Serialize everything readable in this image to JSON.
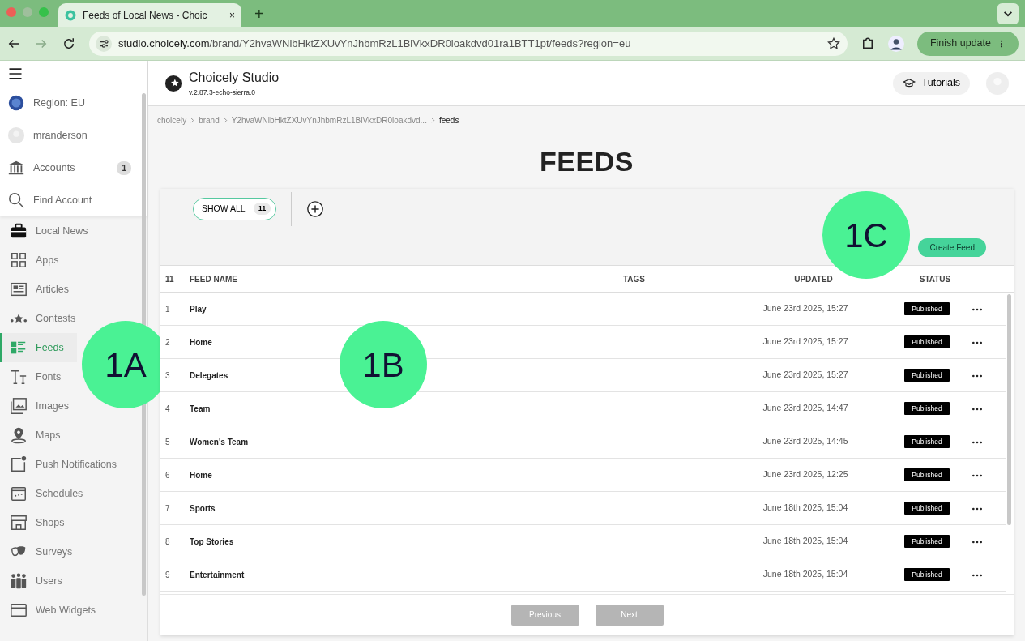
{
  "browser": {
    "tab_title": "Feeds of Local News - Choic",
    "tab_close": "×",
    "new_tab": "+",
    "url_host": "studio.choicely.com",
    "url_path": "/brand/Y2hvaWNlbHktZXUvYnJhbmRzL1BlVkxDR0loakdvd01ra1BTT1pt/feeds?region=eu",
    "update_button": "Finish update"
  },
  "sidebar": {
    "top_items": [
      {
        "kind": "region",
        "label": "Region: EU"
      },
      {
        "kind": "user",
        "label": "mranderson"
      },
      {
        "kind": "accounts",
        "label": "Accounts",
        "count": "1"
      },
      {
        "kind": "search",
        "label": "Find Account"
      }
    ],
    "items": [
      {
        "kind": "briefcase",
        "label": "Local News",
        "selected": false
      },
      {
        "kind": "apps",
        "label": "Apps",
        "selected": false
      },
      {
        "kind": "articles",
        "label": "Articles",
        "selected": false
      },
      {
        "kind": "contests",
        "label": "Contests",
        "selected": false
      },
      {
        "kind": "feeds",
        "label": "Feeds",
        "selected": true
      },
      {
        "kind": "fonts",
        "label": "Fonts",
        "selected": false
      },
      {
        "kind": "images",
        "label": "Images",
        "selected": false
      },
      {
        "kind": "maps",
        "label": "Maps",
        "selected": false
      },
      {
        "kind": "push",
        "label": "Push Notifications",
        "selected": false
      },
      {
        "kind": "schedules",
        "label": "Schedules",
        "selected": false
      },
      {
        "kind": "shops",
        "label": "Shops",
        "selected": false
      },
      {
        "kind": "surveys",
        "label": "Surveys",
        "selected": false
      },
      {
        "kind": "users",
        "label": "Users",
        "selected": false
      },
      {
        "kind": "widgets",
        "label": "Web Widgets",
        "selected": false
      }
    ]
  },
  "header": {
    "app_name": "Choicely Studio",
    "version": "v.2.87.3-echo-sierra.0",
    "tutorials": "Tutorials"
  },
  "breadcrumb": [
    "choicely",
    "brand",
    "Y2hvaWNlbHktZXUvYnJhbmRzL1BlVkxDR0loakdvd...",
    "feeds"
  ],
  "title": "FEEDS",
  "filters": [
    {
      "label": "SHOW ALL",
      "count": "11",
      "selected": true
    }
  ],
  "create_button": "Create Feed",
  "table": {
    "columns": [
      "11",
      "FEED NAME",
      "TAGS",
      "UPDATED",
      "STATUS"
    ],
    "rows": [
      {
        "index": "1",
        "name": "Play",
        "updated": "June 23rd 2025, 15:27",
        "status": "Published"
      },
      {
        "index": "2",
        "name": "Home",
        "updated": "June 23rd 2025, 15:27",
        "status": "Published"
      },
      {
        "index": "3",
        "name": "Delegates",
        "updated": "June 23rd 2025, 15:27",
        "status": "Published"
      },
      {
        "index": "4",
        "name": "Team",
        "updated": "June 23rd 2025, 14:47",
        "status": "Published"
      },
      {
        "index": "5",
        "name": "Women's Team",
        "updated": "June 23rd 2025, 14:45",
        "status": "Published"
      },
      {
        "index": "6",
        "name": "Home",
        "updated": "June 23rd 2025, 12:25",
        "status": "Published"
      },
      {
        "index": "7",
        "name": "Sports",
        "updated": "June 18th 2025, 15:04",
        "status": "Published"
      },
      {
        "index": "8",
        "name": "Top Stories",
        "updated": "June 18th 2025, 15:04",
        "status": "Published"
      },
      {
        "index": "9",
        "name": "Entertainment",
        "updated": "June 18th 2025, 15:04",
        "status": "Published"
      }
    ]
  },
  "pagination": [
    {
      "label": "Previous",
      "disabled": true
    },
    {
      "label": "Next",
      "disabled": true
    }
  ],
  "callouts": [
    {
      "label": "1A"
    },
    {
      "label": "1B"
    },
    {
      "label": "1C"
    }
  ]
}
